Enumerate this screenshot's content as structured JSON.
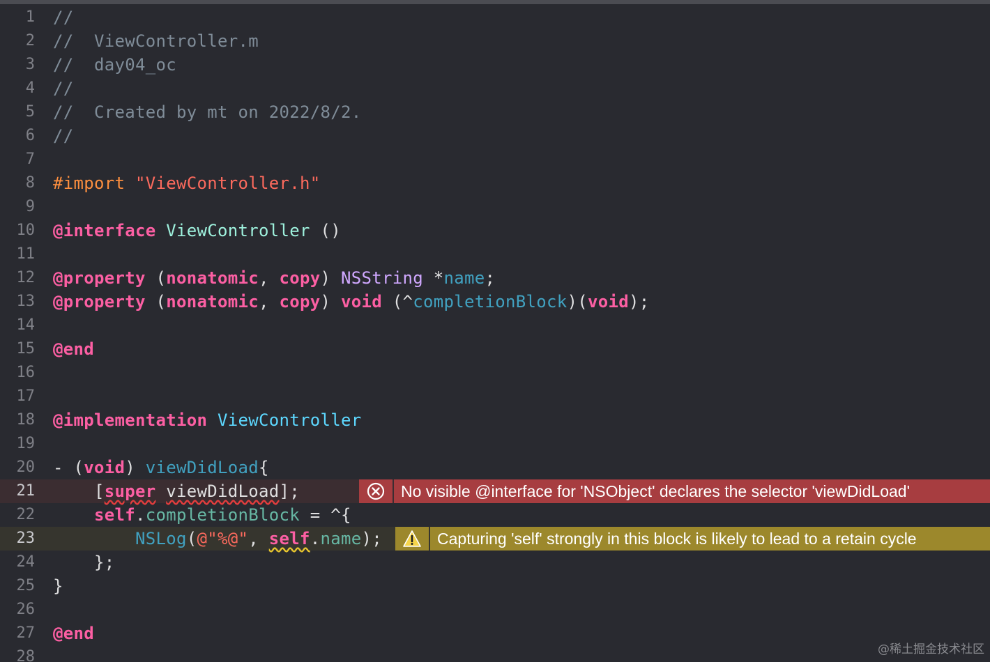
{
  "colors": {
    "background": "#292a30",
    "comment": "#7f8c98",
    "preprocessor": "#fd8f3f",
    "string": "#fc6a5d",
    "keyword": "#fc5fa3",
    "declaration": "#5dd8ff",
    "class": "#9ef1dd",
    "type": "#d0a8ff",
    "property": "#67b7a4",
    "error_bg": "#a73d40",
    "warning_bg": "#9c882c"
  },
  "editor": {
    "lines": [
      {
        "n": "1",
        "tokens": [
          {
            "t": "//",
            "c": "comment"
          }
        ]
      },
      {
        "n": "2",
        "tokens": [
          {
            "t": "//  ViewController.m",
            "c": "comment"
          }
        ]
      },
      {
        "n": "3",
        "tokens": [
          {
            "t": "//  day04_oc",
            "c": "comment"
          }
        ]
      },
      {
        "n": "4",
        "tokens": [
          {
            "t": "//",
            "c": "comment"
          }
        ]
      },
      {
        "n": "5",
        "tokens": [
          {
            "t": "//  Created by mt on 2022/8/2.",
            "c": "comment"
          }
        ]
      },
      {
        "n": "6",
        "tokens": [
          {
            "t": "//",
            "c": "comment"
          }
        ]
      },
      {
        "n": "7",
        "tokens": []
      },
      {
        "n": "8",
        "tokens": [
          {
            "t": "#import ",
            "c": "pre"
          },
          {
            "t": "\"ViewController.h\"",
            "c": "str"
          }
        ]
      },
      {
        "n": "9",
        "tokens": []
      },
      {
        "n": "10",
        "tokens": [
          {
            "t": "@interface",
            "c": "kw"
          },
          {
            "t": " ",
            "c": "plain"
          },
          {
            "t": "ViewController",
            "c": "cls"
          },
          {
            "t": " ()",
            "c": "plain"
          }
        ]
      },
      {
        "n": "11",
        "tokens": []
      },
      {
        "n": "12",
        "tokens": [
          {
            "t": "@property",
            "c": "kw"
          },
          {
            "t": " (",
            "c": "plain"
          },
          {
            "t": "nonatomic",
            "c": "kw"
          },
          {
            "t": ", ",
            "c": "plain"
          },
          {
            "t": "copy",
            "c": "kw"
          },
          {
            "t": ") ",
            "c": "plain"
          },
          {
            "t": "NSString",
            "c": "type"
          },
          {
            "t": " *",
            "c": "plain"
          },
          {
            "t": "name",
            "c": "ident"
          },
          {
            "t": ";",
            "c": "plain"
          }
        ]
      },
      {
        "n": "13",
        "tokens": [
          {
            "t": "@property",
            "c": "kw"
          },
          {
            "t": " (",
            "c": "plain"
          },
          {
            "t": "nonatomic",
            "c": "kw"
          },
          {
            "t": ", ",
            "c": "plain"
          },
          {
            "t": "copy",
            "c": "kw"
          },
          {
            "t": ") ",
            "c": "plain"
          },
          {
            "t": "void",
            "c": "kw"
          },
          {
            "t": " (^",
            "c": "plain"
          },
          {
            "t": "completionBlock",
            "c": "ident"
          },
          {
            "t": ")(",
            "c": "plain"
          },
          {
            "t": "void",
            "c": "kw"
          },
          {
            "t": ");",
            "c": "plain"
          }
        ]
      },
      {
        "n": "14",
        "tokens": []
      },
      {
        "n": "15",
        "tokens": [
          {
            "t": "@end",
            "c": "kw"
          }
        ]
      },
      {
        "n": "16",
        "tokens": []
      },
      {
        "n": "17",
        "tokens": []
      },
      {
        "n": "18",
        "tokens": [
          {
            "t": "@implementation",
            "c": "kw"
          },
          {
            "t": " ",
            "c": "plain"
          },
          {
            "t": "ViewController",
            "c": "decl"
          }
        ]
      },
      {
        "n": "19",
        "tokens": []
      },
      {
        "n": "20",
        "tokens": [
          {
            "t": "- (",
            "c": "plain"
          },
          {
            "t": "void",
            "c": "kw"
          },
          {
            "t": ") ",
            "c": "plain"
          },
          {
            "t": "viewDidLoad",
            "c": "ident"
          },
          {
            "t": "{",
            "c": "plain"
          }
        ]
      },
      {
        "n": "21",
        "tokens": [
          {
            "t": "    [",
            "c": "plain"
          },
          {
            "t": "super",
            "c": "kw",
            "u": "err"
          },
          {
            "t": " ",
            "c": "plain"
          },
          {
            "t": "viewDidLoad",
            "c": "plain",
            "u": "err"
          },
          {
            "t": "];",
            "c": "plain"
          }
        ],
        "state": "error"
      },
      {
        "n": "22",
        "tokens": [
          {
            "t": "    ",
            "c": "plain"
          },
          {
            "t": "self",
            "c": "kw"
          },
          {
            "t": ".",
            "c": "plain"
          },
          {
            "t": "completionBlock",
            "c": "prop"
          },
          {
            "t": " = ^{",
            "c": "plain"
          }
        ]
      },
      {
        "n": "23",
        "tokens": [
          {
            "t": "        ",
            "c": "plain"
          },
          {
            "t": "NSLog",
            "c": "ident"
          },
          {
            "t": "(",
            "c": "plain"
          },
          {
            "t": "@\"%@\"",
            "c": "str"
          },
          {
            "t": ", ",
            "c": "plain"
          },
          {
            "t": "self",
            "c": "kw",
            "u": "warn"
          },
          {
            "t": ".",
            "c": "plain"
          },
          {
            "t": "name",
            "c": "prop"
          },
          {
            "t": ");",
            "c": "plain"
          }
        ],
        "state": "warning"
      },
      {
        "n": "24",
        "tokens": [
          {
            "t": "    };",
            "c": "plain"
          }
        ]
      },
      {
        "n": "25",
        "tokens": [
          {
            "t": "}",
            "c": "plain"
          }
        ]
      },
      {
        "n": "26",
        "tokens": []
      },
      {
        "n": "27",
        "tokens": [
          {
            "t": "@end",
            "c": "kw"
          }
        ]
      },
      {
        "n": "28",
        "tokens": []
      }
    ],
    "annotations": {
      "error": {
        "icon": "error-x-circle-icon",
        "message": "No visible @interface for 'NSObject' declares the selector 'viewDidLoad'"
      },
      "warning": {
        "icon": "warning-triangle-icon",
        "message": "Capturing 'self' strongly in this block is likely to lead to a retain cycle"
      }
    }
  },
  "watermark": "@稀土掘金技术社区"
}
